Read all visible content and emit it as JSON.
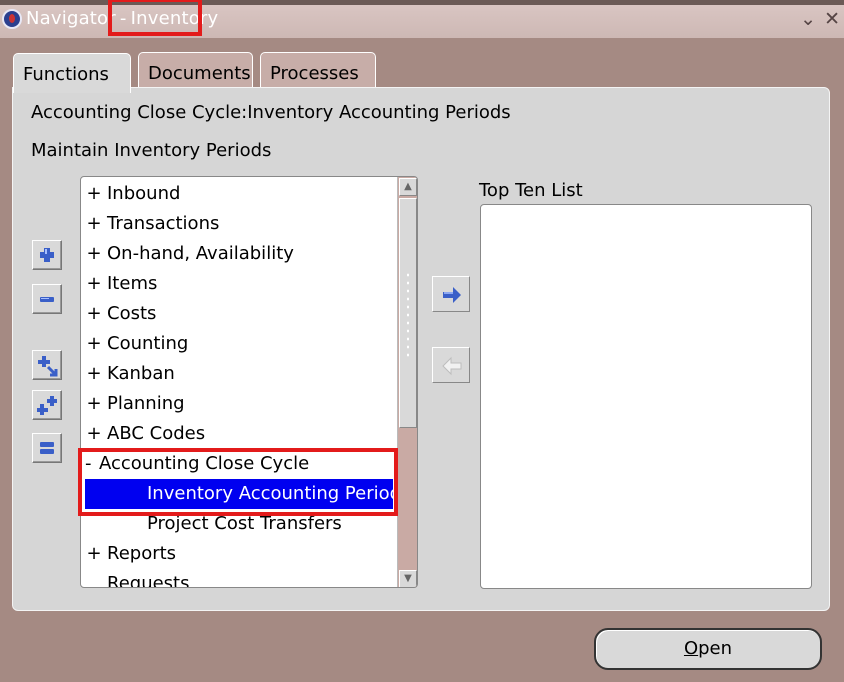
{
  "window": {
    "title_app": "Navigator",
    "title_separator": "-",
    "title_responsibility": "Inventory",
    "minimize_glyph": "⌄",
    "close_glyph": "✕"
  },
  "tabs": [
    {
      "label": "Functions",
      "active": true
    },
    {
      "label": "Documents",
      "active": false
    },
    {
      "label": "Processes",
      "active": false
    }
  ],
  "breadcrumb": "Accounting Close Cycle:Inventory Accounting Periods",
  "function_description": "Maintain Inventory Periods",
  "tree": {
    "items": [
      {
        "mark": "+",
        "label": "Inbound",
        "indent": 0,
        "selected": false
      },
      {
        "mark": "+",
        "label": "Transactions",
        "indent": 0,
        "selected": false
      },
      {
        "mark": "+",
        "label": "On-hand, Availability",
        "indent": 0,
        "selected": false
      },
      {
        "mark": "+",
        "label": "Items",
        "indent": 0,
        "selected": false
      },
      {
        "mark": "+",
        "label": "Costs",
        "indent": 0,
        "selected": false
      },
      {
        "mark": "+",
        "label": "Counting",
        "indent": 0,
        "selected": false
      },
      {
        "mark": "+",
        "label": "Kanban",
        "indent": 0,
        "selected": false
      },
      {
        "mark": "+",
        "label": "Planning",
        "indent": 0,
        "selected": false
      },
      {
        "mark": "+",
        "label": "ABC Codes",
        "indent": 0,
        "selected": false
      },
      {
        "mark": "-",
        "label": "Accounting Close Cycle",
        "indent": 0,
        "selected": false
      },
      {
        "mark": "",
        "label": "Inventory Accounting Periods",
        "indent": 1,
        "selected": true
      },
      {
        "mark": "",
        "label": "Project Cost Transfers",
        "indent": 1,
        "selected": false
      },
      {
        "mark": "+",
        "label": "Reports",
        "indent": 0,
        "selected": false
      },
      {
        "mark": "",
        "label": "Requests",
        "indent": 0,
        "selected": false
      }
    ]
  },
  "top_ten": {
    "label": "Top Ten List",
    "items": []
  },
  "open_button": {
    "mnemonic": "O",
    "rest": "pen"
  },
  "colors": {
    "background": "#a58a83",
    "selection": "#0000f0",
    "highlight_box": "#e31b1b",
    "arrow_blue": "#3a5fc8"
  }
}
